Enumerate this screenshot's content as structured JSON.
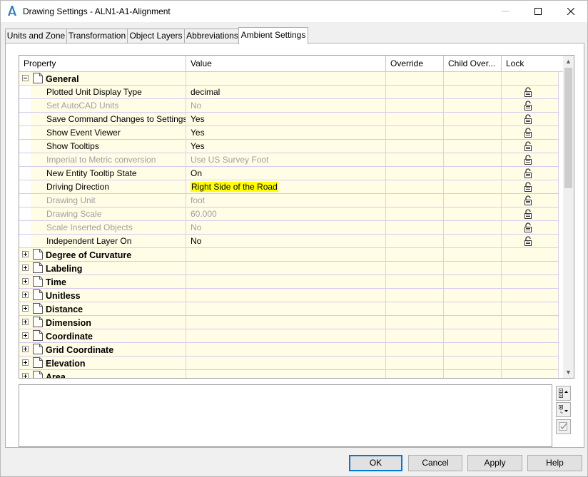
{
  "window": {
    "title": "Drawing Settings - ALN1-A1-Alignment"
  },
  "tabs": [
    {
      "label": "Units and Zone"
    },
    {
      "label": "Transformation"
    },
    {
      "label": "Object Layers"
    },
    {
      "label": "Abbreviations"
    },
    {
      "label": "Ambient Settings"
    }
  ],
  "grid": {
    "columns": [
      "Property",
      "Value",
      "Override",
      "Child Over...",
      "Lock"
    ],
    "general": {
      "label": "General",
      "rows": [
        {
          "property": "Plotted Unit Display Type",
          "value": "decimal",
          "dim": false
        },
        {
          "property": "Set AutoCAD Units",
          "value": "No",
          "dim": true
        },
        {
          "property": "Save Command Changes to Settings",
          "value": "Yes",
          "dim": false
        },
        {
          "property": "Show Event Viewer",
          "value": "Yes",
          "dim": false
        },
        {
          "property": "Show Tooltips",
          "value": "Yes",
          "dim": false
        },
        {
          "property": "Imperial to Metric conversion",
          "value": "Use US Survey Foot",
          "dim": true
        },
        {
          "property": "New Entity Tooltip State",
          "value": "On",
          "dim": false
        },
        {
          "property": "Driving Direction",
          "value": "Right Side of the Road",
          "dim": false
        },
        {
          "property": "Drawing Unit",
          "value": "foot",
          "dim": true
        },
        {
          "property": "Drawing Scale",
          "value": "60.000",
          "dim": true
        },
        {
          "property": "Scale Inserted Objects",
          "value": "No",
          "dim": true
        },
        {
          "property": "Independent Layer On",
          "value": "No",
          "dim": false
        }
      ]
    },
    "categories": [
      "Degree of Curvature",
      "Labeling",
      "Time",
      "Unitless",
      "Distance",
      "Dimension",
      "Coordinate",
      "Grid Coordinate",
      "Elevation",
      "Area"
    ]
  },
  "buttons": {
    "ok": "OK",
    "cancel": "Cancel",
    "apply": "Apply",
    "help": "Help"
  },
  "icons": {
    "app": "autocad-civil-a-icon",
    "row": "document-icon",
    "lock": "padlock-icon"
  },
  "colors": {
    "row_bg": "#fffde6",
    "grid_line": "#d8c9ee",
    "highlight": "#ffff00",
    "default_button_border": "#0078d7"
  }
}
